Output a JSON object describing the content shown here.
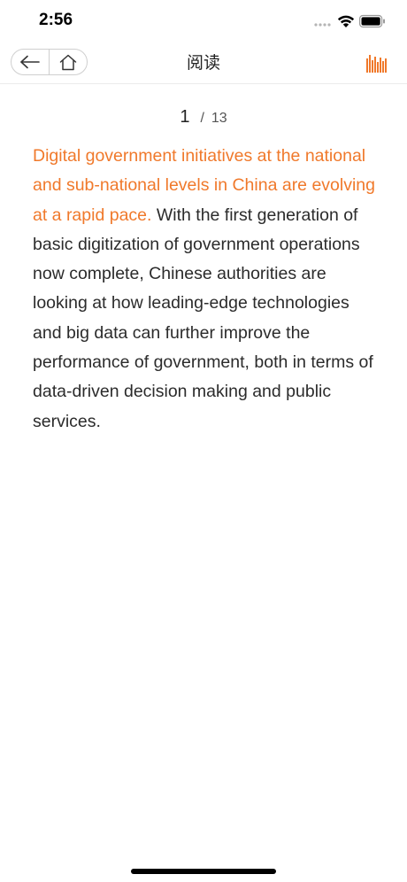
{
  "status_bar": {
    "time": "2:56"
  },
  "nav": {
    "title": "阅读",
    "back_icon": "arrow-left-icon",
    "home_icon": "home-icon",
    "audio_icon": "audio-waveform-icon"
  },
  "pager": {
    "current": "1",
    "separator": "/",
    "total": "13"
  },
  "article": {
    "highlight_text": "Digital government initiatives at the national and sub-national levels in China are evolving at a rapid pace.",
    "body_text": " With the first generation of basic digitization of government operations now complete, Chinese authorities are looking at how leading-edge technologies and big data can further improve the performance of government,  both in terms of data-driven decision making and public services."
  },
  "colors": {
    "accent": "#f0792b",
    "text": "#2b2b2b"
  }
}
